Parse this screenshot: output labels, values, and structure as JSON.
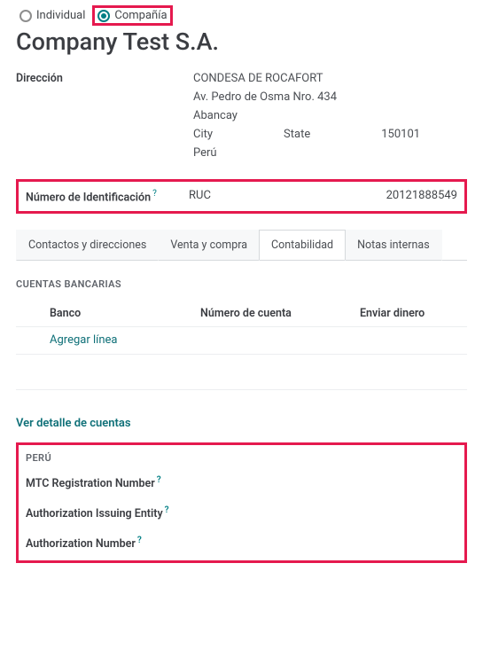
{
  "entity_type": {
    "individual_label": "Individual",
    "company_label": "Compañía"
  },
  "company_name": "Company Test S.A.",
  "address": {
    "section_label": "Dirección",
    "name": "CONDESA DE ROCAFORT",
    "street": "Av. Pedro de Osma Nro. 434",
    "city2": "Abancay",
    "city": "City",
    "state": "State",
    "zip": "150101",
    "country": "Perú"
  },
  "identification": {
    "label": "Número de Identificación",
    "type": "RUC",
    "value": "20121888549"
  },
  "tabs": {
    "contacts": "Contactos y direcciones",
    "sales": "Venta y compra",
    "accounting": "Contabilidad",
    "notes": "Notas internas"
  },
  "bank": {
    "caption": "CUENTAS BANCARIAS",
    "col_bank": "Banco",
    "col_account": "Número de cuenta",
    "col_send": "Enviar dinero",
    "add_line": "Agregar línea",
    "detail_link": "Ver detalle de cuentas"
  },
  "peru": {
    "caption": "PERÚ",
    "mtc_label": "MTC Registration Number",
    "auth_entity_label": "Authorization Issuing Entity",
    "auth_number_label": "Authorization Number"
  },
  "help_char": "?"
}
